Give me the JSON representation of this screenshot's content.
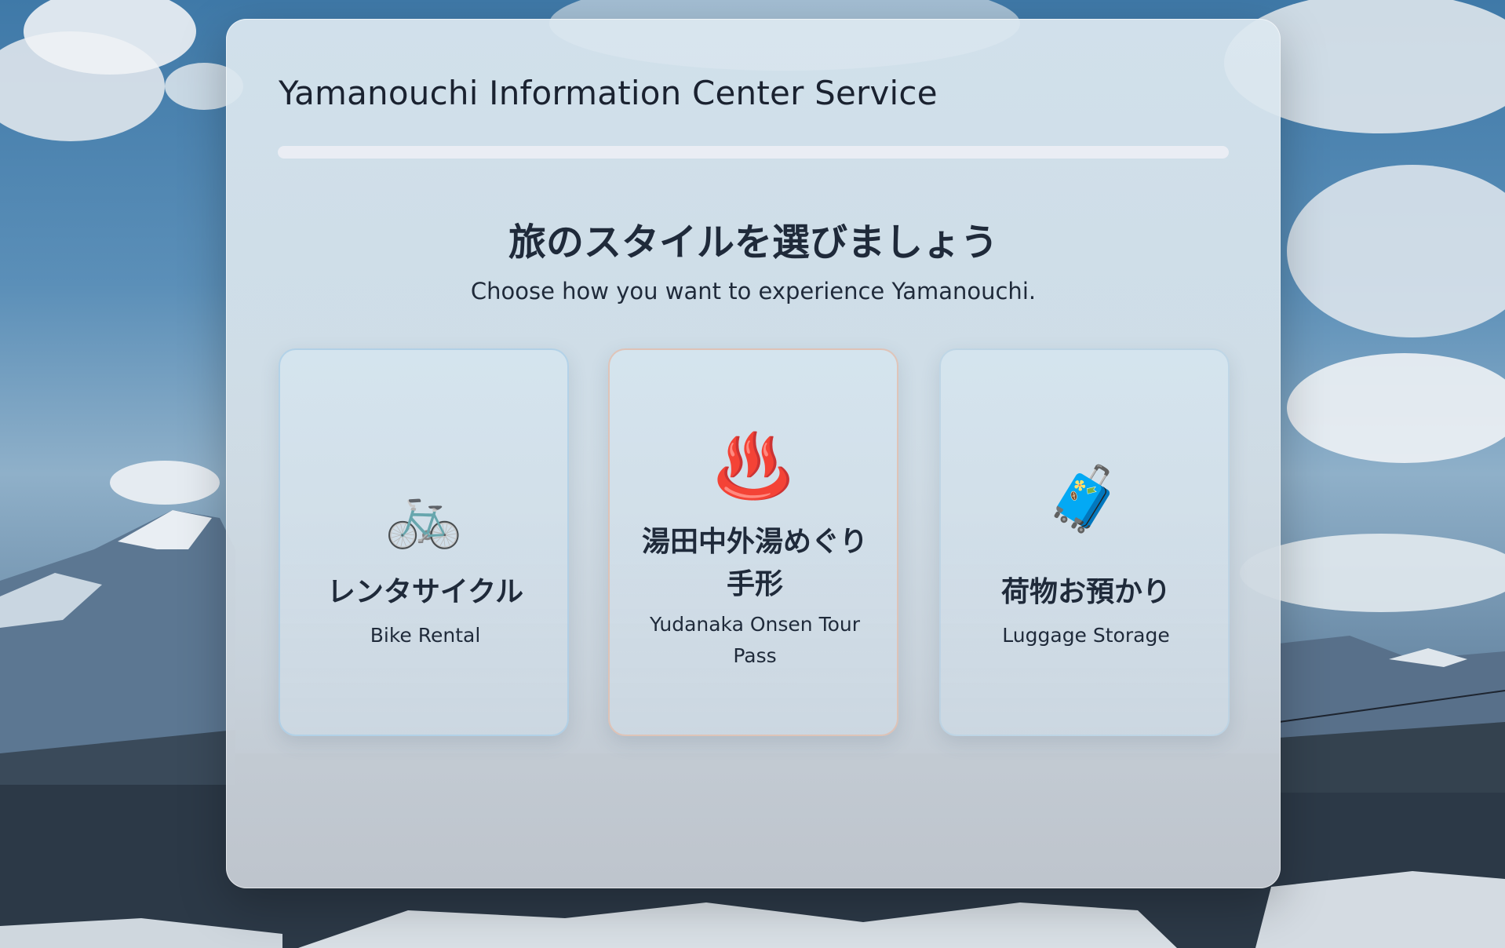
{
  "header": {
    "title": "Yamanouchi Information Center Service",
    "progress": 0
  },
  "main": {
    "heading_jp": "旅のスタイルを選びましょう",
    "heading_en": "Choose how you want to experience Yamanouchi."
  },
  "options": [
    {
      "icon": "bicycle-icon",
      "glyph": "🚲",
      "label_jp": "レンタサイクル",
      "label_en": "Bike Rental"
    },
    {
      "icon": "hot-springs-icon",
      "glyph": "♨️",
      "label_jp": "湯田中外湯めぐり手形",
      "label_en": "Yudanaka Onsen Tour Pass"
    },
    {
      "icon": "luggage-icon",
      "glyph": "🧳",
      "label_jp": "荷物お預かり",
      "label_en": "Luggage Storage"
    }
  ]
}
